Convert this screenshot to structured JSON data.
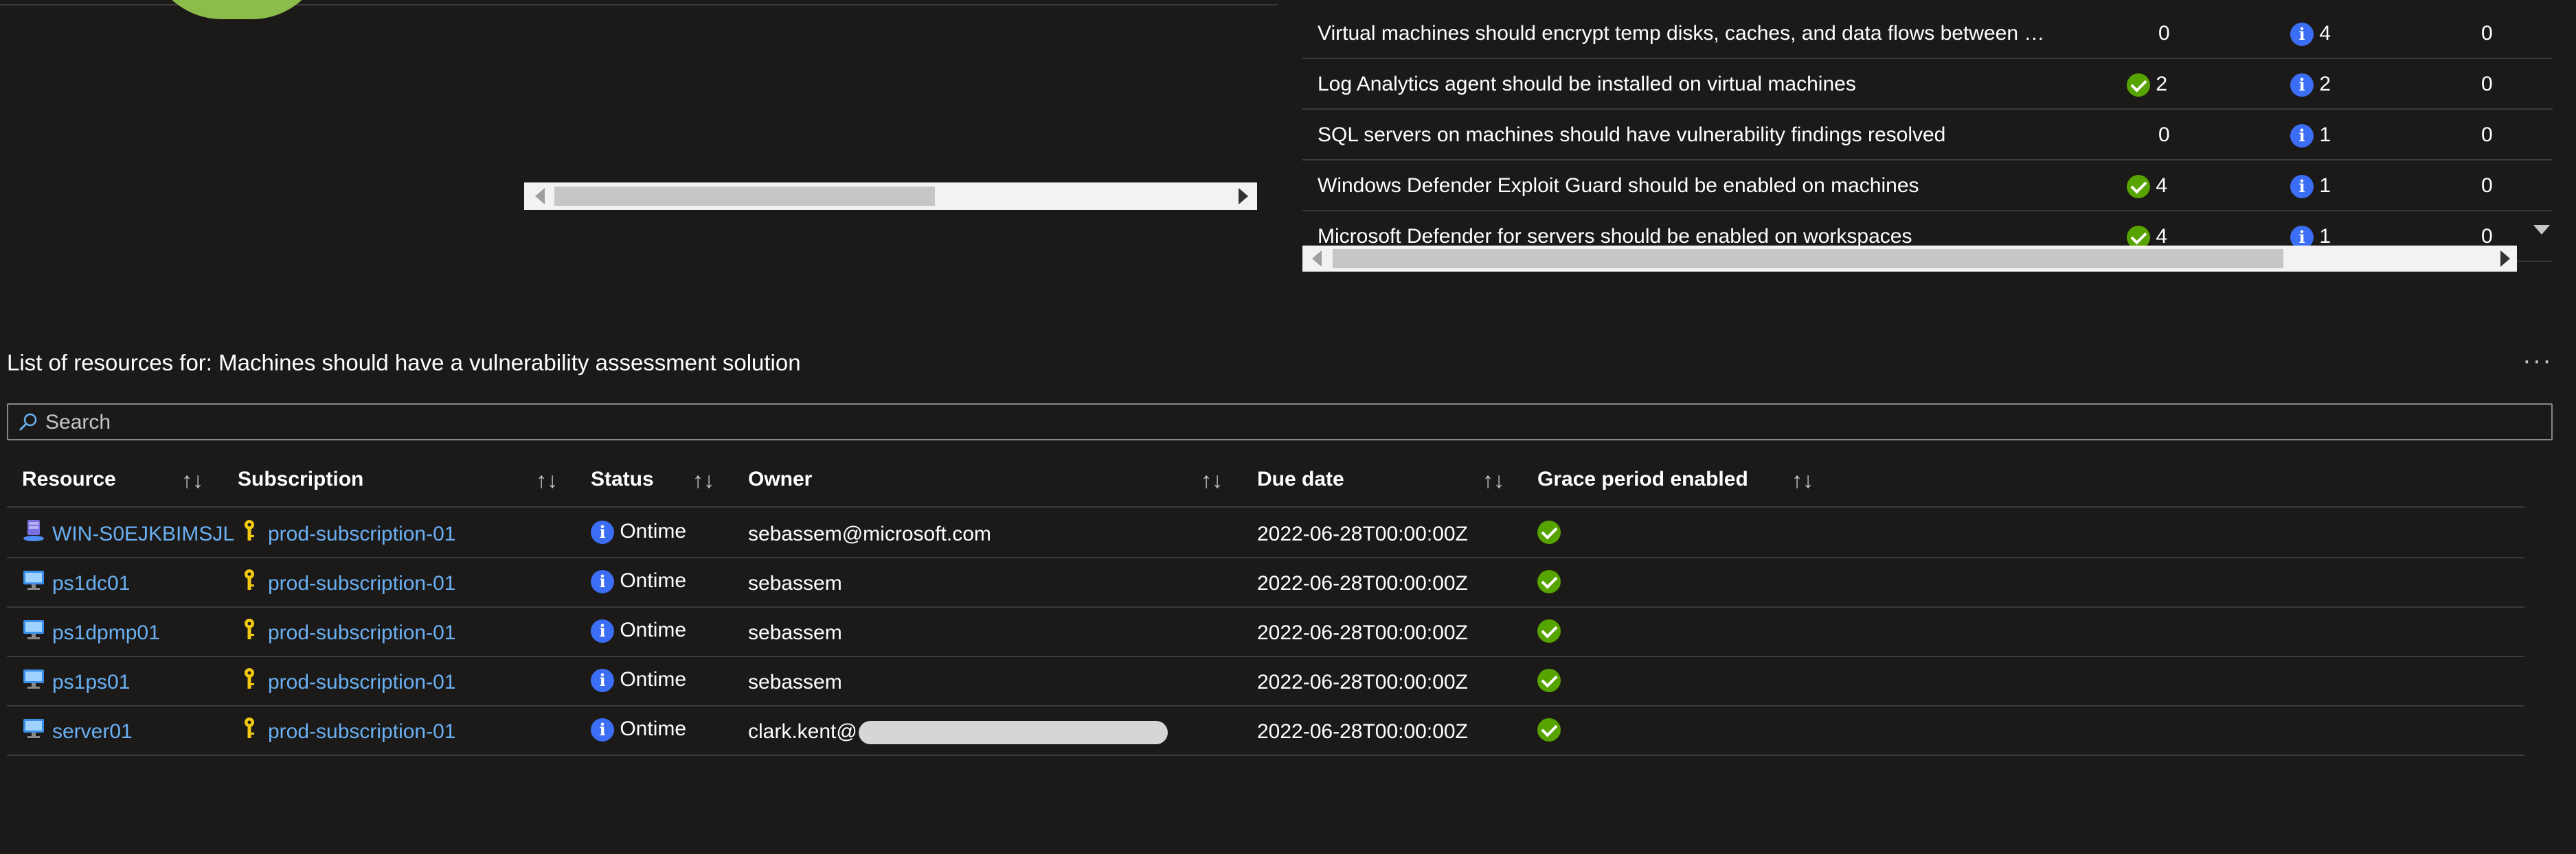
{
  "recommendations": [
    {
      "name": "Virtual machines should encrypt temp disks, caches, and data flows between Compute a...",
      "healthy": "0",
      "healthy_icon": false,
      "unhealthy": "4",
      "not_applicable": "0"
    },
    {
      "name": "Log Analytics agent should be installed on virtual machines",
      "healthy": "2",
      "healthy_icon": true,
      "unhealthy": "2",
      "not_applicable": "0"
    },
    {
      "name": "SQL servers on machines should have vulnerability findings resolved",
      "healthy": "0",
      "healthy_icon": false,
      "unhealthy": "1",
      "not_applicable": "0"
    },
    {
      "name": "Windows Defender Exploit Guard should be enabled on machines",
      "healthy": "4",
      "healthy_icon": true,
      "unhealthy": "1",
      "not_applicable": "0"
    },
    {
      "name": "Microsoft Defender for servers should be enabled on workspaces",
      "healthy": "4",
      "healthy_icon": true,
      "unhealthy": "1",
      "not_applicable": "0"
    }
  ],
  "list": {
    "title": "List of resources for: Machines should have a vulnerability assessment solution",
    "more_label": "···",
    "search_placeholder": "Search",
    "columns": {
      "resource": "Resource",
      "subscription": "Subscription",
      "status": "Status",
      "owner": "Owner",
      "due_date": "Due date",
      "grace": "Grace period enabled"
    },
    "sort_glyph": "↑↓",
    "rows": [
      {
        "resource": "WIN-S0EJKBIMSJL",
        "icon": "arc-server-icon",
        "subscription": "prod-subscription-01",
        "status": "Ontime",
        "owner": "sebassem@microsoft.com",
        "due": "2022-06-28T00:00:00Z"
      },
      {
        "resource": "ps1dc01",
        "icon": "virtual-machine-icon",
        "subscription": "prod-subscription-01",
        "status": "Ontime",
        "owner": "sebassem",
        "due": "2022-06-28T00:00:00Z"
      },
      {
        "resource": "ps1dpmp01",
        "icon": "virtual-machine-icon",
        "subscription": "prod-subscription-01",
        "status": "Ontime",
        "owner": "sebassem",
        "due": "2022-06-28T00:00:00Z"
      },
      {
        "resource": "ps1ps01",
        "icon": "virtual-machine-icon",
        "subscription": "prod-subscription-01",
        "status": "Ontime",
        "owner": "sebassem",
        "due": "2022-06-28T00:00:00Z"
      },
      {
        "resource": "server01",
        "icon": "virtual-machine-icon",
        "subscription": "prod-subscription-01",
        "status": "Ontime",
        "owner": "clark.kent@",
        "due": "2022-06-28T00:00:00Z"
      }
    ]
  },
  "colors": {
    "background": "#1b1a19",
    "link": "#6ab0f3",
    "healthy": "#57a300",
    "info": "#3b6ef5",
    "chart_fill": "#8cbd4b"
  }
}
